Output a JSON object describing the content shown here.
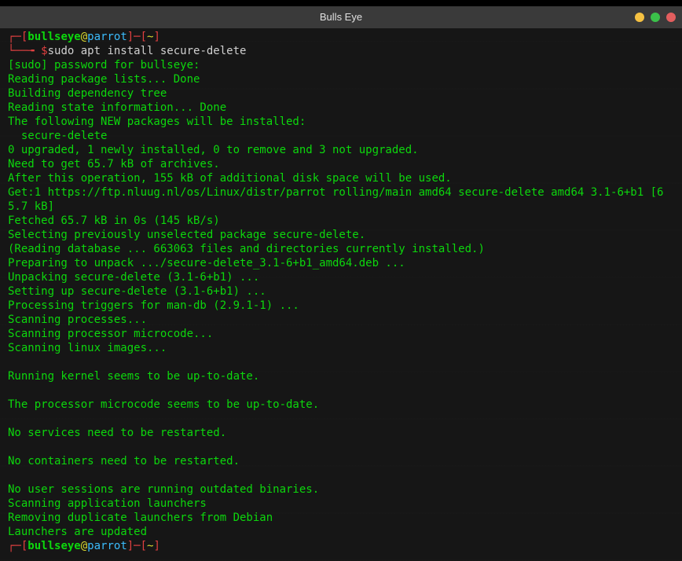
{
  "window": {
    "title": "Bulls Eye"
  },
  "prompt1": {
    "open": "┌─[",
    "user": "bullseye",
    "at": "@",
    "host": "parrot",
    "sep1": "]─[",
    "path": "~",
    "close": "]",
    "line2_prefix": "└──╼ ",
    "dollar": "$",
    "command": "sudo apt install secure-delete"
  },
  "output_lines": [
    "[sudo] password for bullseye:",
    "Reading package lists... Done",
    "Building dependency tree",
    "Reading state information... Done",
    "The following NEW packages will be installed:",
    "  secure-delete",
    "0 upgraded, 1 newly installed, 0 to remove and 3 not upgraded.",
    "Need to get 65.7 kB of archives.",
    "After this operation, 155 kB of additional disk space will be used.",
    "Get:1 https://ftp.nluug.nl/os/Linux/distr/parrot rolling/main amd64 secure-delete amd64 3.1-6+b1 [65.7 kB]",
    "Fetched 65.7 kB in 0s (145 kB/s)",
    "Selecting previously unselected package secure-delete.",
    "(Reading database ... 663063 files and directories currently installed.)",
    "Preparing to unpack .../secure-delete_3.1-6+b1_amd64.deb ...",
    "Unpacking secure-delete (3.1-6+b1) ...",
    "Setting up secure-delete (3.1-6+b1) ...",
    "Processing triggers for man-db (2.9.1-1) ...",
    "Scanning processes...",
    "Scanning processor microcode...",
    "Scanning linux images...",
    "",
    "Running kernel seems to be up-to-date.",
    "",
    "The processor microcode seems to be up-to-date.",
    "",
    "No services need to be restarted.",
    "",
    "No containers need to be restarted.",
    "",
    "No user sessions are running outdated binaries.",
    "Scanning application launchers",
    "Removing duplicate launchers from Debian",
    "Launchers are updated"
  ],
  "prompt2": {
    "open": "┌─[",
    "user": "bullseye",
    "at": "@",
    "host": "parrot",
    "sep1": "]─[",
    "path": "~",
    "close": "]"
  }
}
